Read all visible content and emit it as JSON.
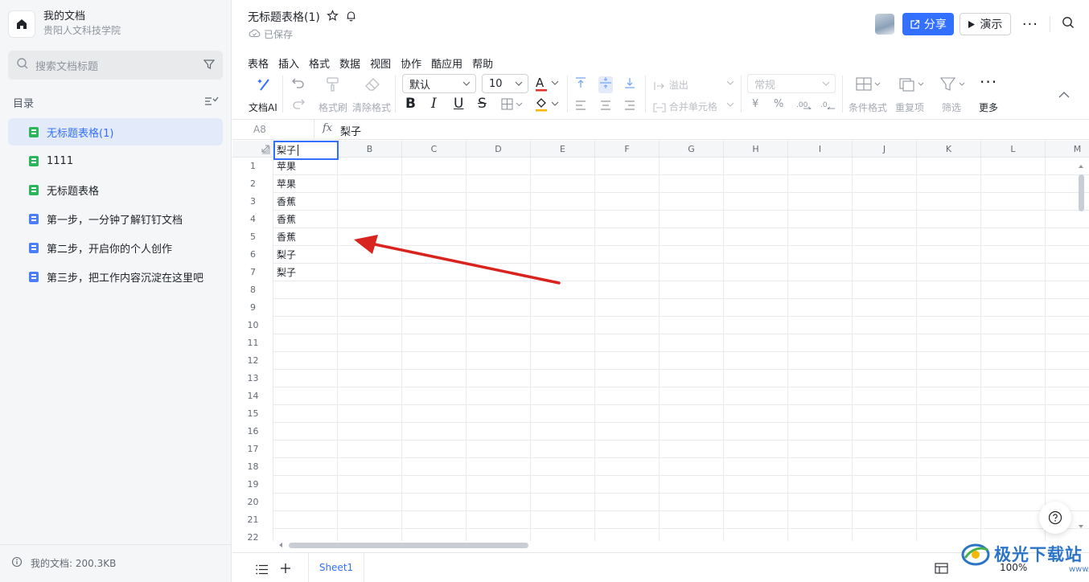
{
  "workspace": {
    "name": "我的文档",
    "org": "贵阳人文科技学院"
  },
  "sidebar": {
    "search_placeholder": "搜索文档标题",
    "toc_title": "目录",
    "items": [
      {
        "label": "无标题表格(1)",
        "type": "sheet",
        "active": true
      },
      {
        "label": "1111",
        "type": "sheet"
      },
      {
        "label": "无标题表格",
        "type": "sheet"
      },
      {
        "label": "第一步，一分钟了解钉钉文档",
        "type": "doc"
      },
      {
        "label": "第二步，开启你的个人创作",
        "type": "doc"
      },
      {
        "label": "第三步，把工作内容沉淀在这里吧",
        "type": "doc"
      }
    ],
    "storage": "我的文档: 200.3KB"
  },
  "header": {
    "title": "无标题表格(1)",
    "status": "已保存",
    "share_label": "分享",
    "present_label": "演示",
    "more": "···"
  },
  "menu": [
    "表格",
    "插入",
    "格式",
    "数据",
    "视图",
    "协作",
    "酷应用",
    "帮助"
  ],
  "toolbar": {
    "ai_label": "文档AI",
    "format_painter": "格式刷",
    "clear_format": "清除格式",
    "font": "默认",
    "font_size": "10",
    "bold": "B",
    "italic": "I",
    "underline": "U",
    "strike": "S",
    "overflow": "溢出",
    "merge": "合并单元格",
    "number_format": "常规",
    "currency": "¥",
    "percent": "%",
    "cond_format": "条件格式",
    "duplicates": "重复项",
    "filter": "筛选",
    "more": "更多",
    "accent_red": "#e0312d",
    "accent_fill": "#f7b500"
  },
  "formula": {
    "cell_ref": "A8",
    "fx": "fx",
    "value": "梨子"
  },
  "grid": {
    "columns": [
      "A",
      "B",
      "C",
      "D",
      "E",
      "F",
      "G",
      "H",
      "I",
      "J",
      "K",
      "L",
      "M"
    ],
    "rows": [
      "1",
      "2",
      "3",
      "4",
      "5",
      "6",
      "7",
      "8",
      "9",
      "10",
      "11",
      "12",
      "13",
      "14",
      "15",
      "16",
      "17",
      "18",
      "19",
      "20",
      "21",
      "22"
    ],
    "column_a": [
      "苹果",
      "苹果",
      "香蕉",
      "香蕉",
      "香蕉",
      "梨子",
      "梨子"
    ],
    "editing_cell": {
      "ref": "A8",
      "value": "梨子"
    }
  },
  "bottom": {
    "sheet_tab": "Sheet1",
    "zoom": "100%"
  },
  "watermark": {
    "text": "极光下载站",
    "url": "www.xz7.com"
  },
  "colors": {
    "primary": "#3370ff",
    "annotation_arrow": "#d8231f"
  }
}
